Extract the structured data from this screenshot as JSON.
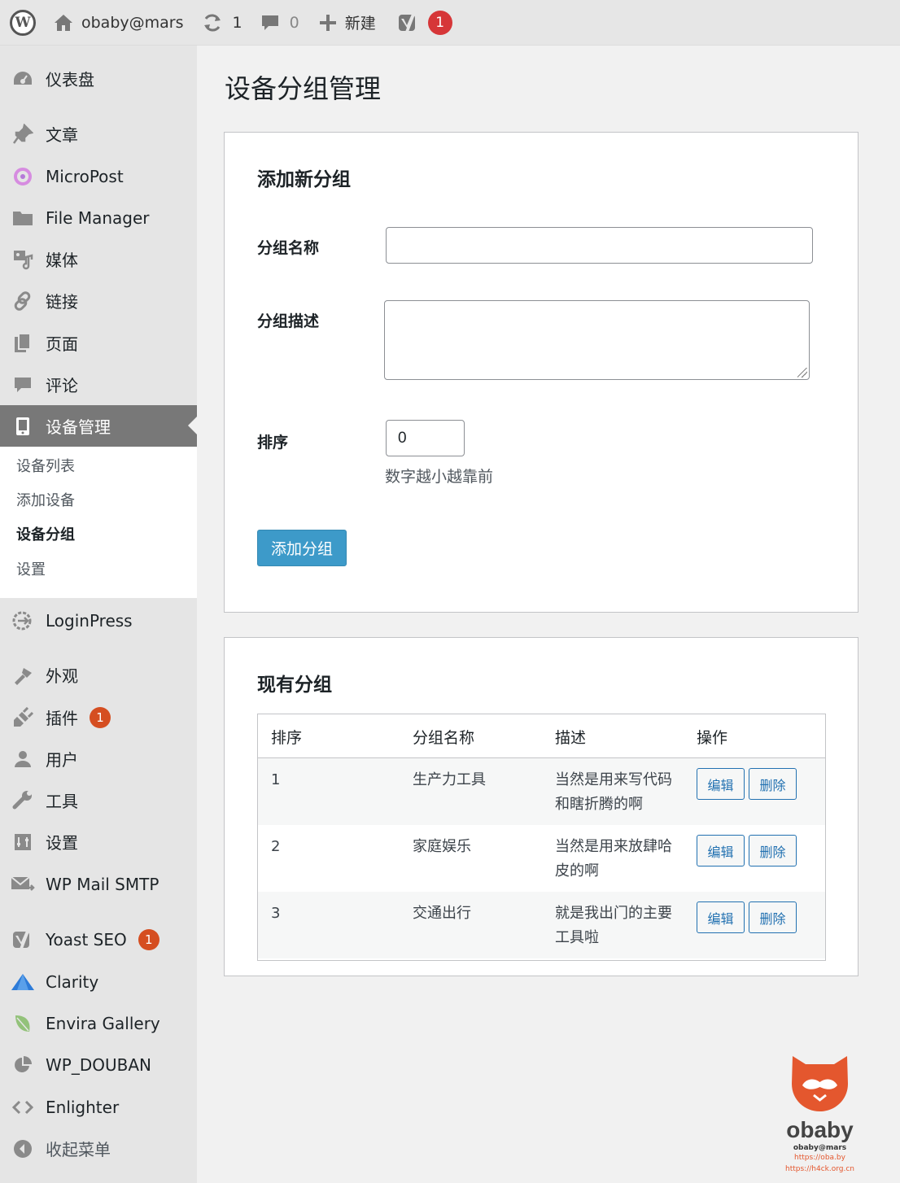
{
  "adminbar": {
    "site_name": "obaby@mars",
    "updates_count": "1",
    "comments_count": "0",
    "new_label": "新建",
    "yoast_badge": "1"
  },
  "sidebar": {
    "items": [
      {
        "label": "仪表盘",
        "icon": "dashboard-icon"
      },
      {
        "label": "文章",
        "icon": "pin-icon"
      },
      {
        "label": "MicroPost",
        "icon": "micropost-icon"
      },
      {
        "label": "File Manager",
        "icon": "folder-icon"
      },
      {
        "label": "媒体",
        "icon": "media-icon"
      },
      {
        "label": "链接",
        "icon": "link-icon"
      },
      {
        "label": "页面",
        "icon": "page-icon"
      },
      {
        "label": "评论",
        "icon": "comment-icon"
      },
      {
        "label": "设备管理",
        "icon": "device-icon"
      },
      {
        "label": "LoginPress",
        "icon": "loginpress-icon"
      },
      {
        "label": "外观",
        "icon": "brush-icon"
      },
      {
        "label": "插件",
        "icon": "plugin-icon",
        "badge": "1"
      },
      {
        "label": "用户",
        "icon": "user-icon"
      },
      {
        "label": "工具",
        "icon": "wrench-icon"
      },
      {
        "label": "设置",
        "icon": "settings-icon"
      },
      {
        "label": "WP Mail SMTP",
        "icon": "mail-icon"
      },
      {
        "label": "Yoast SEO",
        "icon": "yoast-icon",
        "badge": "1"
      },
      {
        "label": "Clarity",
        "icon": "clarity-icon"
      },
      {
        "label": "Envira Gallery",
        "icon": "leaf-icon"
      },
      {
        "label": "WP_DOUBAN",
        "icon": "pie-icon"
      },
      {
        "label": "Enlighter",
        "icon": "code-icon"
      },
      {
        "label": "收起菜单",
        "icon": "collapse-icon"
      }
    ],
    "submenu": [
      "设备列表",
      "添加设备",
      "设备分组",
      "设置"
    ]
  },
  "main": {
    "title": "设备分组管理",
    "add_card": {
      "heading": "添加新分组",
      "name_label": "分组名称",
      "name_value": "",
      "desc_label": "分组描述",
      "desc_value": "",
      "order_label": "排序",
      "order_value": "0",
      "order_hint": "数字越小越靠前",
      "submit_label": "添加分组"
    },
    "list_card": {
      "heading": "现有分组",
      "columns": [
        "排序",
        "分组名称",
        "描述",
        "操作"
      ],
      "rows": [
        {
          "order": "1",
          "name": "生产力工具",
          "desc": "当然是用来写代码和瞎折腾的啊"
        },
        {
          "order": "2",
          "name": "家庭娱乐",
          "desc": "当然是用来放肆哈皮的啊"
        },
        {
          "order": "3",
          "name": "交通出行",
          "desc": "就是我出门的主要工具啦"
        }
      ],
      "edit_label": "编辑",
      "delete_label": "删除"
    }
  },
  "brand": {
    "word": "obaby",
    "tag": "obaby@mars",
    "url1": "https://oba.by",
    "url2": "https://h4ck.org.cn"
  },
  "colors": {
    "primary_button": "#3d9ac9",
    "active_menu": "#787878",
    "badge_red": "#d63638",
    "badge_orange": "#d54e21",
    "brand_orange": "#e4572e"
  }
}
